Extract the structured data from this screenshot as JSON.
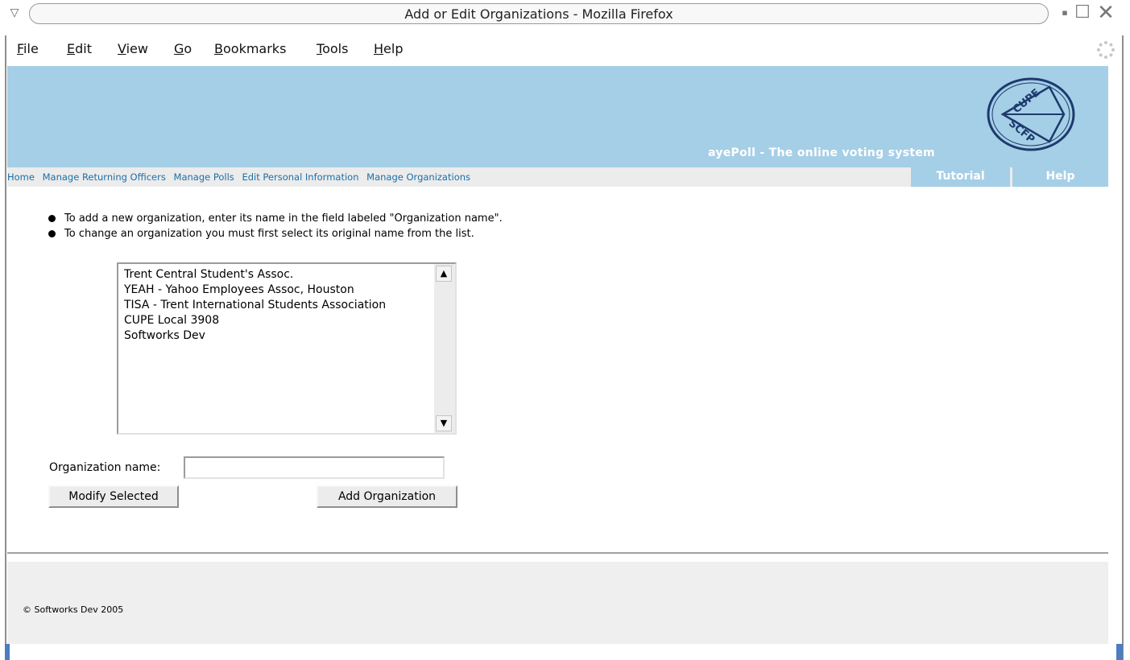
{
  "window": {
    "title": "Add or Edit Organizations - Mozilla Firefox",
    "menu_glyph": "▽",
    "min_glyph": "▪",
    "max_glyph": "☐",
    "close_glyph": "✕"
  },
  "menubar": {
    "items": [
      {
        "key": "F",
        "rest": "ile"
      },
      {
        "key": "E",
        "rest": "dit"
      },
      {
        "key": "V",
        "rest": "iew"
      },
      {
        "key": "G",
        "rest": "o"
      },
      {
        "key": "B",
        "rest": "ookmarks"
      },
      {
        "key": "T",
        "rest": "ools"
      },
      {
        "key": "H",
        "rest": "elp"
      }
    ]
  },
  "banner": {
    "tagline": "ayePoll - The online voting system",
    "logo_top": "CUPE",
    "logo_bottom": "SCFP"
  },
  "nav": {
    "links": [
      "Home",
      "Manage Returning Officers",
      "Manage Polls",
      "Edit Personal Information",
      "Manage Organizations"
    ],
    "tutorial": "Tutorial",
    "help": "Help"
  },
  "instructions": [
    "To add a new organization, enter its name in the field labeled \"Organization name\".",
    "To change an organization you must first select its original name from the list."
  ],
  "organizations": [
    "Trent Central Student's Assoc.",
    "YEAH - Yahoo Employees Assoc, Houston",
    "TISA - Trent International Students Association",
    "CUPE Local 3908",
    "Softworks Dev"
  ],
  "form": {
    "org_label": "Organization name:",
    "org_value": "",
    "modify_label": "Modify Selected",
    "add_label": "Add Organization"
  },
  "footer": {
    "copyright": "© Softworks Dev 2005"
  },
  "colors": {
    "banner": "#a5cfe6",
    "nav_link": "#1b6fa8",
    "navbar_bg": "#ececec"
  }
}
